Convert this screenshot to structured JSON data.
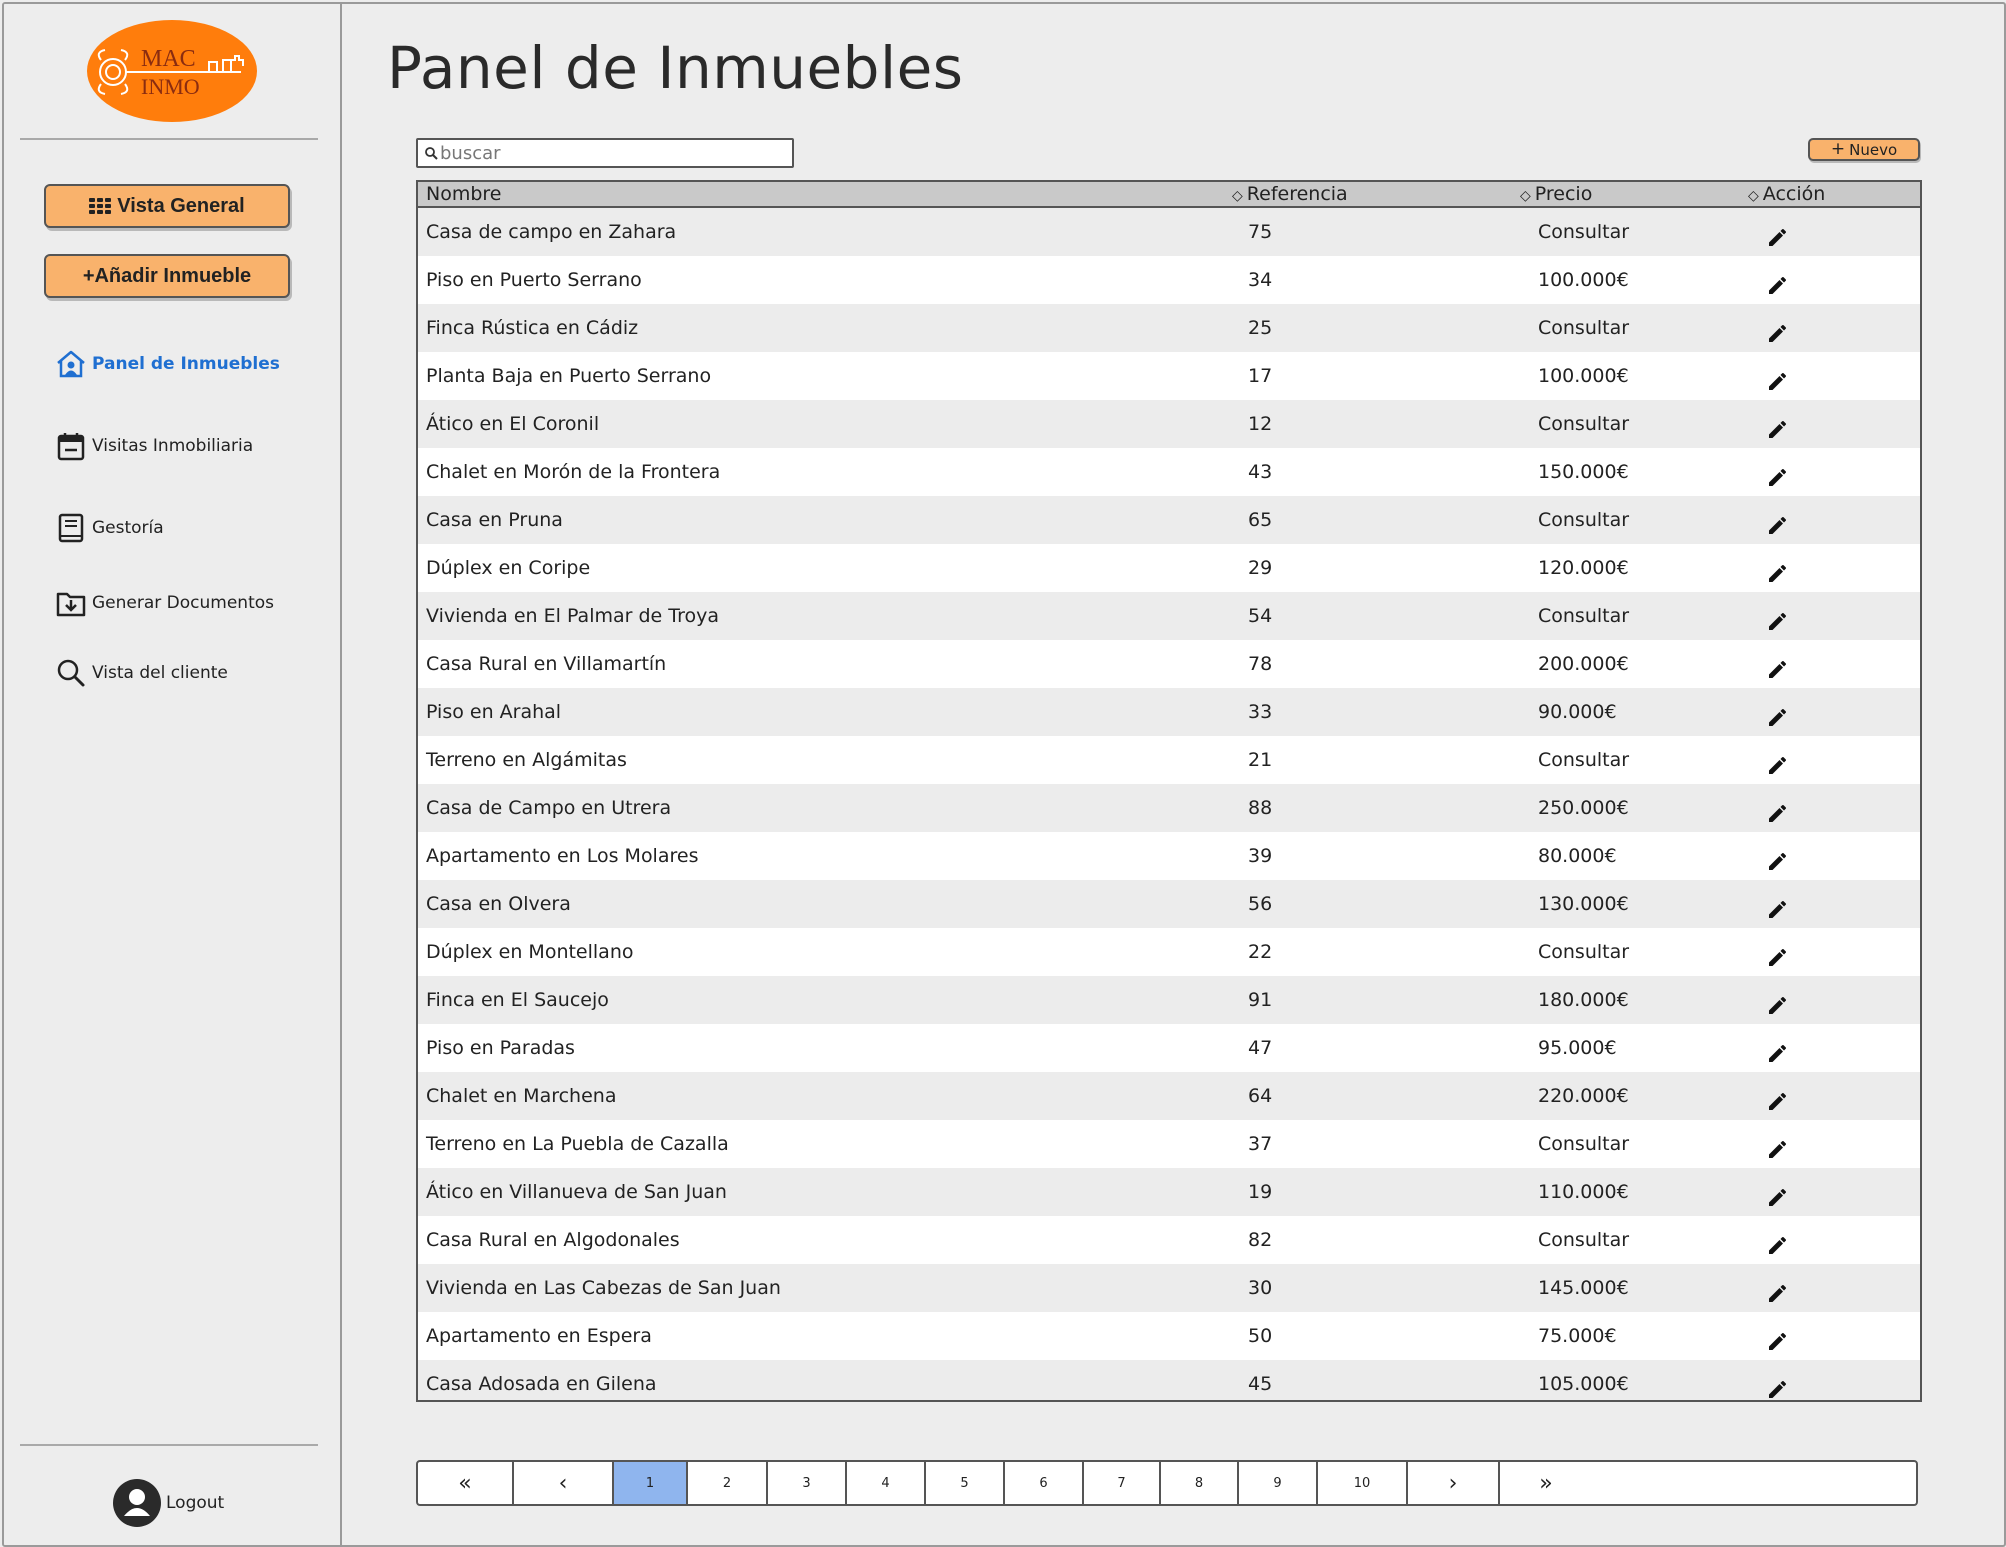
{
  "logo": {
    "line1": "MAC",
    "line2": "INMO",
    "brand_color": "#ff7d0c"
  },
  "sidebar": {
    "buttons": [
      {
        "label": "Vista General",
        "icon": "grid-icon"
      },
      {
        "label": "+Añadir Inmueble"
      }
    ],
    "items": [
      {
        "label": "Panel de Inmuebles",
        "icon": "house-user-icon",
        "active": true
      },
      {
        "label": "Visitas Inmobiliaria",
        "icon": "calendar-icon"
      },
      {
        "label": "Gestoría",
        "icon": "book-icon"
      },
      {
        "label": "Generar Documentos",
        "icon": "folder-download-icon"
      },
      {
        "label": "Vista del cliente",
        "icon": "search-icon"
      }
    ],
    "logout": {
      "label": "Logout",
      "icon": "user-avatar-icon"
    }
  },
  "page": {
    "title": "Panel de Inmuebles"
  },
  "search": {
    "placeholder": "buscar"
  },
  "new_button": {
    "label": "Nuevo"
  },
  "table": {
    "columns": {
      "name": "Nombre",
      "ref": "Referencia",
      "price": "Precio",
      "action": "Acción"
    },
    "rows": [
      {
        "name": "Casa de campo en Zahara",
        "ref": "75",
        "price": "Consultar"
      },
      {
        "name": "Piso en Puerto Serrano",
        "ref": "34",
        "price": "100.000€"
      },
      {
        "name": "Finca Rústica en Cádiz",
        "ref": "25",
        "price": "Consultar"
      },
      {
        "name": "Planta Baja en Puerto Serrano",
        "ref": "17",
        "price": "100.000€"
      },
      {
        "name": "Ático en El Coronil",
        "ref": "12",
        "price": "Consultar"
      },
      {
        "name": "Chalet en Morón de la Frontera",
        "ref": "43",
        "price": "150.000€"
      },
      {
        "name": "Casa en Pruna",
        "ref": "65",
        "price": "Consultar"
      },
      {
        "name": "Dúplex en Coripe",
        "ref": "29",
        "price": "120.000€"
      },
      {
        "name": "Vivienda en El Palmar de Troya",
        "ref": "54",
        "price": "Consultar"
      },
      {
        "name": "Casa Rural en Villamartín",
        "ref": "78",
        "price": "200.000€"
      },
      {
        "name": "Piso en Arahal",
        "ref": "33",
        "price": "90.000€"
      },
      {
        "name": "Terreno en Algámitas",
        "ref": "21",
        "price": "Consultar"
      },
      {
        "name": "Casa de Campo en Utrera",
        "ref": "88",
        "price": "250.000€"
      },
      {
        "name": "Apartamento en Los Molares",
        "ref": "39",
        "price": "80.000€"
      },
      {
        "name": "Casa en Olvera",
        "ref": "56",
        "price": "130.000€"
      },
      {
        "name": "Dúplex en Montellano",
        "ref": "22",
        "price": "Consultar"
      },
      {
        "name": "Finca en El Saucejo",
        "ref": "91",
        "price": "180.000€"
      },
      {
        "name": "Piso en Paradas",
        "ref": "47",
        "price": "95.000€"
      },
      {
        "name": "Chalet en Marchena",
        "ref": "64",
        "price": "220.000€"
      },
      {
        "name": "Terreno en La Puebla de Cazalla",
        "ref": "37",
        "price": "Consultar"
      },
      {
        "name": "Ático en Villanueva de San Juan",
        "ref": "19",
        "price": "110.000€"
      },
      {
        "name": "Casa Rural en Algodonales",
        "ref": "82",
        "price": "Consultar"
      },
      {
        "name": "Vivienda en Las Cabezas de San Juan",
        "ref": "30",
        "price": "145.000€"
      },
      {
        "name": "Apartamento en Espera",
        "ref": "50",
        "price": "75.000€"
      },
      {
        "name": "Casa Adosada en Gilena",
        "ref": "45",
        "price": "105.000€"
      }
    ]
  },
  "pagination": {
    "first": "«",
    "prev": "‹",
    "next": "›",
    "last": "»",
    "pages": [
      "1",
      "2",
      "3",
      "4",
      "5",
      "6",
      "7",
      "8",
      "9",
      "10"
    ],
    "current": "1",
    "active_color": "#8fb5ee"
  }
}
